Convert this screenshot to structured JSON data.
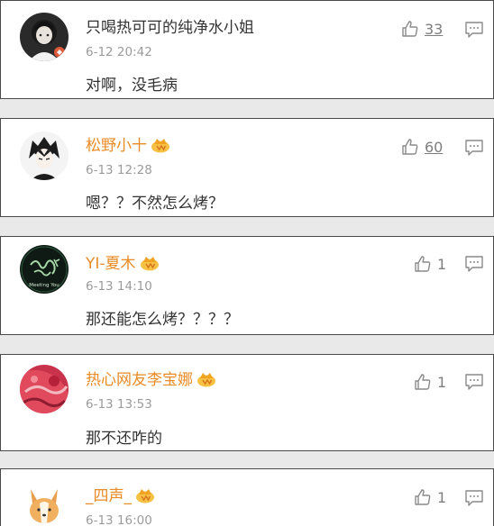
{
  "comments": [
    {
      "username": "只喝热可可的纯净水小姐",
      "username_color": "#333333",
      "vip": false,
      "timestamp": "6-12 20:42",
      "text": "对啊，没毛病",
      "likes": "33",
      "avatar": "girl-dark-avatar"
    },
    {
      "username": "松野小十",
      "username_color": "#e98b26",
      "vip": true,
      "timestamp": "6-13 12:28",
      "text": "嗯？？不然怎么烤？",
      "likes": "60",
      "avatar": "anime-boy-avatar"
    },
    {
      "username": "YI-夏木",
      "username_color": "#e98b26",
      "vip": true,
      "timestamp": "6-13 14:10",
      "text": "那还能怎么烤？？？？",
      "likes": "1",
      "avatar": "green-calligraphy-avatar",
      "avatar_text": "Meeting You"
    },
    {
      "username": "热心网友李宝娜",
      "username_color": "#e98b26",
      "vip": true,
      "timestamp": "6-13 13:53",
      "text": "那不还咋的",
      "likes": "1",
      "avatar": "red-abstract-avatar"
    },
    {
      "username": "_四声_",
      "username_color": "#e98b26",
      "vip": true,
      "timestamp": "6-13 16:00",
      "text": "",
      "likes": "1",
      "avatar": "corgi-avatar"
    }
  ],
  "icons": {
    "like": "thumbs-up-icon",
    "reply": "comment-bubble-icon",
    "vip": "vip-crown-badge-icon"
  }
}
